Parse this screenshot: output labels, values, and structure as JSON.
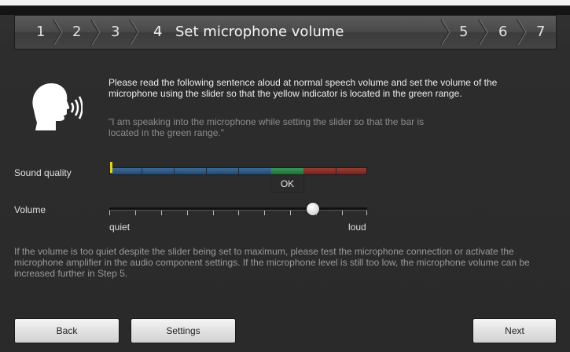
{
  "steps": {
    "s1": "1",
    "s2": "2",
    "s3": "3",
    "s4": "4",
    "s5": "5",
    "s6": "6",
    "s7": "7",
    "active_title": "Set microphone volume"
  },
  "content": {
    "instruction": "Please read the following sentence aloud at normal speech volume and set the volume of the microphone using the slider so that the yellow indicator is located in the green range.",
    "quote": "\"I am speaking into the microphone while setting the slider so that the bar is located in the green range.\"",
    "sound_quality_label": "Sound quality",
    "ok_label": "OK",
    "volume_label": "Volume",
    "quiet_label": "quiet",
    "loud_label": "loud",
    "note": "If the volume is too quiet despite the slider being set to maximum, please test the microphone connection or activate the microphone amplifier in the audio component settings. If the microphone level is still too low, the microphone volume can be increased further in Step 5."
  },
  "buttons": {
    "back": "Back",
    "settings": "Settings",
    "next": "Next"
  },
  "levels": {
    "volume_fraction": 0.79,
    "sound_indicator_fraction": 0.0
  },
  "icons": {
    "speaker": "speaking-head-icon"
  },
  "colors": {
    "quality_low": "#2f5d88",
    "quality_ok": "#2f8a4a",
    "quality_high": "#8a3430",
    "indicator": "#e6d21a"
  }
}
